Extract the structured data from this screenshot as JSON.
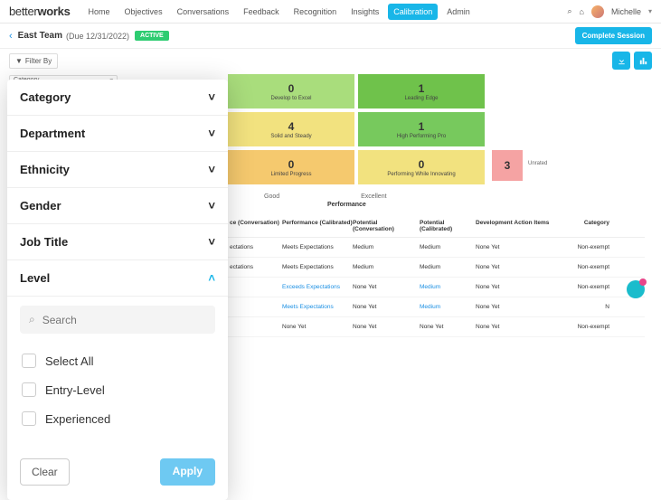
{
  "brand": "betterworks",
  "nav": [
    "Home",
    "Objectives",
    "Conversations",
    "Feedback",
    "Recognition",
    "Insights",
    "Calibration",
    "Admin"
  ],
  "nav_active": 6,
  "user": {
    "name": "Michelle"
  },
  "session": {
    "back": "‹",
    "title": "East Team",
    "due": "(Due 12/31/2022)",
    "status": "ACTIVE",
    "complete_btn": "Complete Session"
  },
  "toolbar": {
    "filter_by": "Filter By",
    "dropdown": "Category"
  },
  "filters": {
    "sections": [
      "Category",
      "Department",
      "Ethnicity",
      "Gender",
      "Job Title",
      "Level"
    ],
    "open_index": 5,
    "search_placeholder": "Search",
    "options": [
      "Select All",
      "Entry-Level",
      "Experienced"
    ],
    "clear": "Clear",
    "apply": "Apply"
  },
  "chart_data": {
    "type": "table",
    "title": "Performance",
    "cells": [
      {
        "value": 0,
        "label": "Develop to Excel",
        "color": "#a9dd7c"
      },
      {
        "value": 1,
        "label": "Leading Edge",
        "color": "#6fc24b"
      },
      {
        "value": 4,
        "label": "Solid and Steady",
        "color": "#f2e27f"
      },
      {
        "value": 1,
        "label": "High Performing Pro",
        "color": "#77c95d"
      },
      {
        "value": 0,
        "label": "Limited Progress",
        "color": "#f5c96e"
      },
      {
        "value": 0,
        "label": "Performing While Innovating",
        "color": "#f2e27f"
      }
    ],
    "x_axis": [
      "Good",
      "Excellent"
    ],
    "x_label": "Performance",
    "extra": {
      "value": 3,
      "label": "Unrated",
      "color": "#f5a3a3"
    }
  },
  "table": {
    "headers": [
      "ce (Conversation)",
      "Performance (Calibrated)",
      "Potential (Conversation)",
      "Potential (Calibrated)",
      "Development Action Items",
      "Category"
    ],
    "rows": [
      {
        "c1": "ectations",
        "c2": "Meets Expectations",
        "c2_link": false,
        "c3": "Medium",
        "c4": "Medium",
        "c4_link": false,
        "c5": "None Yet",
        "c6": "Non-exempt"
      },
      {
        "c1": "ectations",
        "c2": "Meets Expectations",
        "c2_link": false,
        "c3": "Medium",
        "c4": "Medium",
        "c4_link": false,
        "c5": "None Yet",
        "c6": "Non-exempt"
      },
      {
        "c1": "",
        "c2": "Exceeds Expectations",
        "c2_link": true,
        "c3": "None Yet",
        "c4": "Medium",
        "c4_link": true,
        "c5": "None Yet",
        "c6": "Non-exempt"
      },
      {
        "c1": "",
        "c2": "Meets Expectations",
        "c2_link": true,
        "c3": "None Yet",
        "c4": "Medium",
        "c4_link": true,
        "c5": "None Yet",
        "c6": "N"
      },
      {
        "c1": "",
        "c2": "None Yet",
        "c2_link": false,
        "c3": "None Yet",
        "c4": "None Yet",
        "c4_link": false,
        "c5": "None Yet",
        "c6": "Non-exempt"
      }
    ]
  }
}
